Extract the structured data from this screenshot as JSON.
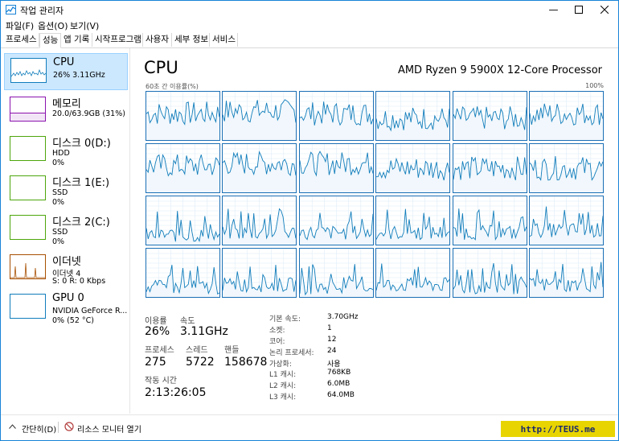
{
  "window": {
    "title": "작업 관리자"
  },
  "menu": [
    "파일(F)",
    "옵션(O)",
    "보기(V)"
  ],
  "tabs": [
    "프로세스",
    "성능",
    "앱 기록",
    "시작프로그램",
    "사용자",
    "세부 정보",
    "서비스"
  ],
  "active_tab": 1,
  "sidebar": [
    {
      "title": "CPU",
      "sub1": "26% 3.11GHz",
      "sub2": "",
      "color": "#117dbb"
    },
    {
      "title": "메모리",
      "sub1": "20.0/63.9GB (31%)",
      "sub2": "",
      "color": "#8b12ae"
    },
    {
      "title": "디스크 0(D:)",
      "sub1": "HDD",
      "sub2": "0%",
      "color": "#4da60c"
    },
    {
      "title": "디스크 1(E:)",
      "sub1": "SSD",
      "sub2": "0%",
      "color": "#4da60c"
    },
    {
      "title": "디스크 2(C:)",
      "sub1": "SSD",
      "sub2": "0%",
      "color": "#4da60c"
    },
    {
      "title": "이더넷",
      "sub1": "이더넷 4",
      "sub2": "S: 0 R: 0 Kbps",
      "color": "#a74f01"
    },
    {
      "title": "GPU 0",
      "sub1": "NVIDIA GeForce R...",
      "sub2": "0% (52 °C)",
      "color": "#117dbb"
    }
  ],
  "cpu": {
    "title": "CPU",
    "model": "AMD Ryzen 9 5900X 12-Core Processor",
    "graph_label_left": "60초 간 이용률(%)",
    "graph_label_right": "100%",
    "stats": {
      "util_label": "이용률",
      "util": "26%",
      "speed_label": "속도",
      "speed": "3.11GHz",
      "proc_label": "프로세스",
      "proc": "275",
      "threads_label": "스레드",
      "threads": "5722",
      "handles_label": "핸들",
      "handles": "158678",
      "uptime_label": "작동 시간",
      "uptime": "2:13:26:05"
    },
    "specs": [
      {
        "k": "기본 속도:",
        "v": "3.70GHz"
      },
      {
        "k": "소켓:",
        "v": "1"
      },
      {
        "k": "코어:",
        "v": "12"
      },
      {
        "k": "논리 프로세서:",
        "v": "24"
      },
      {
        "k": "가상화:",
        "v": "사용"
      },
      {
        "k": "L1 캐시:",
        "v": "768KB"
      },
      {
        "k": "L2 캐시:",
        "v": "6.0MB"
      },
      {
        "k": "L3 캐시:",
        "v": "64.0MB"
      }
    ],
    "core_levels": [
      0.55,
      0.6,
      0.55,
      0.45,
      0.45,
      0.55,
      0.55,
      0.6,
      0.6,
      0.5,
      0.5,
      0.5,
      0.2,
      0.25,
      0.25,
      0.25,
      0.25,
      0.3,
      0.2,
      0.25,
      0.2,
      0.25,
      0.2,
      0.25
    ]
  },
  "status": {
    "fewer_details": "간단히(D)",
    "resource_monitor": "리소스 모니터 열기"
  },
  "watermark": "http://TEUS.me",
  "colors": {
    "accent": "#117dbb",
    "selected": "#cce8ff"
  }
}
